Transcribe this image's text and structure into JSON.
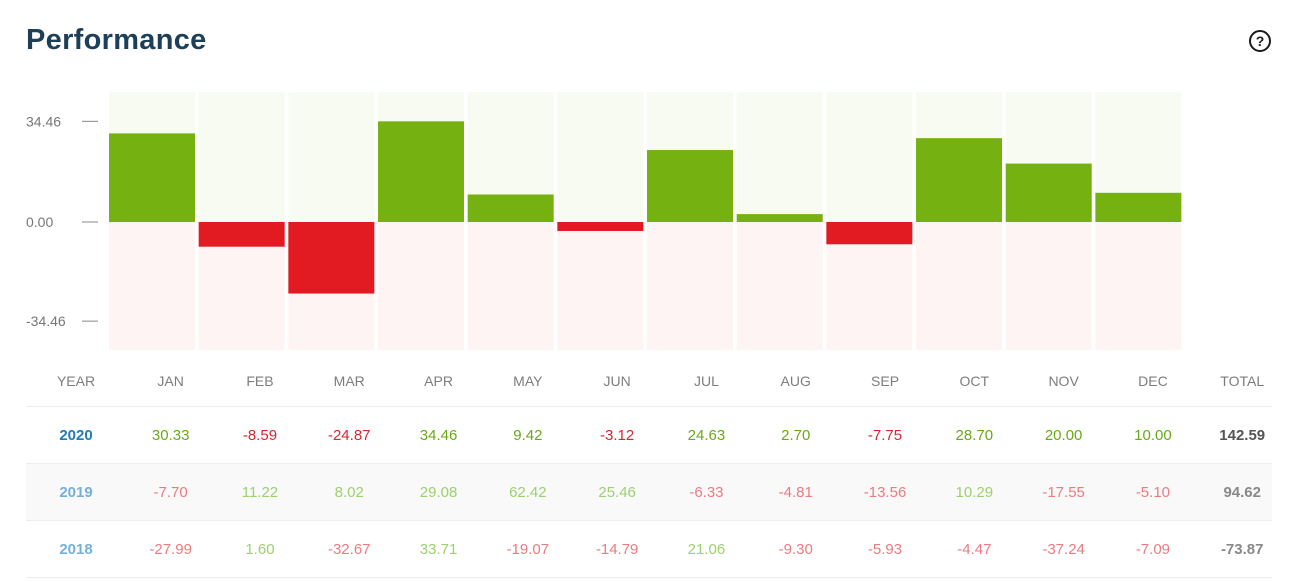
{
  "title": "Performance",
  "help_icon": "?",
  "colors": {
    "positive_bar": "#75b211",
    "negative_bar": "#e21a22",
    "positive_bg": "#f7fbf1",
    "negative_bg": "#fff4f4",
    "pos_text_strong": "#6aa914",
    "neg_text_strong": "#d9262d",
    "pos_text_light": "#9dd06f",
    "neg_text_light": "#ec7b80",
    "year_strong": "#1f7bb9",
    "year_light": "#73b1dd",
    "total_strong": "#555555",
    "total_light": "#888888"
  },
  "chart_data": {
    "type": "bar",
    "categories": [
      "JAN",
      "FEB",
      "MAR",
      "APR",
      "MAY",
      "JUN",
      "JUL",
      "AUG",
      "SEP",
      "OCT",
      "NOV",
      "DEC"
    ],
    "series": [
      {
        "name": "2020",
        "values": [
          30.33,
          -8.59,
          -24.87,
          34.46,
          9.42,
          -3.12,
          24.63,
          2.7,
          -7.75,
          28.7,
          20.0,
          10.0
        ]
      }
    ],
    "ylim": [
      -44.5,
      44.5
    ],
    "y_ticks": [
      34.46,
      0.0,
      -34.46
    ],
    "y_tick_labels": [
      "34.46",
      "0.00",
      "-34.46"
    ]
  },
  "table": {
    "header": [
      "YEAR",
      "JAN",
      "FEB",
      "MAR",
      "APR",
      "MAY",
      "JUN",
      "JUL",
      "AUG",
      "SEP",
      "OCT",
      "NOV",
      "DEC",
      "TOTAL"
    ],
    "rows": [
      {
        "year": "2020",
        "values": [
          "30.33",
          "-8.59",
          "-24.87",
          "34.46",
          "9.42",
          "-3.12",
          "24.63",
          "2.70",
          "-7.75",
          "28.70",
          "20.00",
          "10.00"
        ],
        "total": "142.59"
      },
      {
        "year": "2019",
        "values": [
          "-7.70",
          "11.22",
          "8.02",
          "29.08",
          "62.42",
          "25.46",
          "-6.33",
          "-4.81",
          "-13.56",
          "10.29",
          "-17.55",
          "-5.10"
        ],
        "total": "94.62"
      },
      {
        "year": "2018",
        "values": [
          "-27.99",
          "1.60",
          "-32.67",
          "33.71",
          "-19.07",
          "-14.79",
          "21.06",
          "-9.30",
          "-5.93",
          "-4.47",
          "-37.24",
          "-7.09"
        ],
        "total": "-73.87"
      }
    ]
  }
}
